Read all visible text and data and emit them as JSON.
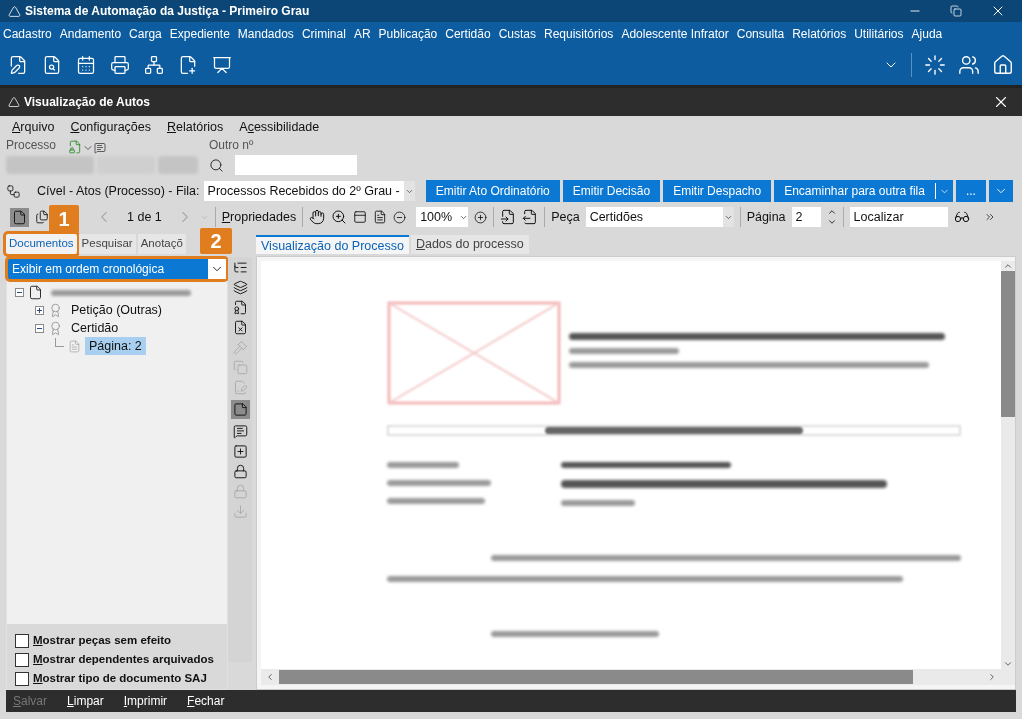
{
  "app_title": "Sistema de Automação da Justiça - Primeiro Grau",
  "main_menu": [
    "Cadastro",
    "Andamento",
    "Carga",
    "Expediente",
    "Mandados",
    "Criminal",
    "AR",
    "Publicação",
    "Certidão",
    "Custas",
    "Requisitórios",
    "Adolescente Infrator",
    "Consulta",
    "Relatórios",
    "Utilitários",
    "Ajuda"
  ],
  "window": {
    "title": "Visualização de Autos"
  },
  "menu": [
    {
      "key": "A",
      "post": "rquivo"
    },
    {
      "key": "C",
      "post": "onfigurações"
    },
    {
      "key": "R",
      "post": "elatórios"
    },
    {
      "pre": "A",
      "key": "c",
      "post": "essibilidade"
    }
  ],
  "process": {
    "label": "Processo",
    "other_label": "Outro nº"
  },
  "queue": {
    "label": "Cível - Atos (Processo) - Fila:",
    "value": "Processos Recebidos do 2º Grau -"
  },
  "actions": [
    {
      "kind": "plain",
      "label": "Emitir Ato Ordinatório"
    },
    {
      "kind": "plain",
      "label": "Emitir Decisão"
    },
    {
      "kind": "plain",
      "label": "Emitir Despacho"
    },
    {
      "kind": "split",
      "label": "Encaminhar para outra fila"
    },
    {
      "kind": "plain",
      "label": "..."
    },
    {
      "kind": "icon"
    }
  ],
  "viewer_toolbar": {
    "pager": "1 de 1",
    "properties": {
      "key": "P",
      "post": "ropriedades"
    },
    "zoom": "100%",
    "piece_label": "Peça",
    "piece": "Certidões",
    "page_label": "Página",
    "page": "2",
    "find_placeholder": "Localizar"
  },
  "callouts": [
    "1",
    "2"
  ],
  "left_tabs": [
    {
      "label": "Documentos",
      "selected": true
    },
    {
      "label": "Pesquisar",
      "selected": false
    },
    {
      "label": "Anotaçõ",
      "selected": false
    }
  ],
  "order_select": "Exibir em ordem cronológica",
  "tree": [
    {
      "kind": "process",
      "expanded": true,
      "selected": false,
      "children": [
        {
          "kind": "piece",
          "label": "Petição (Outras)",
          "expanded": false,
          "selected": false
        },
        {
          "kind": "piece",
          "label": "Certidão",
          "expanded": true,
          "selected": false,
          "children": [
            {
              "kind": "page",
              "label": "Página: 2",
              "selected": true
            }
          ]
        }
      ]
    }
  ],
  "options": [
    {
      "key": "M",
      "post": "ostrar peças sem efeito",
      "checked": false
    },
    {
      "key": "M",
      "post": "ostrar dependentes arquivados",
      "checked": false
    },
    {
      "key": "M",
      "post": "ostrar tipo de documento SAJ",
      "checked": false
    }
  ],
  "viewer_tabs": [
    {
      "label": "Visualização do Processo",
      "selected": true
    },
    {
      "key": "D",
      "post": "ados do processo",
      "selected": false
    }
  ],
  "footer": [
    {
      "key": "S",
      "post": "alvar",
      "disabled": true
    },
    {
      "key": "L",
      "post": "impar",
      "disabled": false
    },
    {
      "key": "I",
      "post": "mprimir",
      "disabled": false
    },
    {
      "key": "F",
      "post": "echar",
      "disabled": false
    }
  ]
}
